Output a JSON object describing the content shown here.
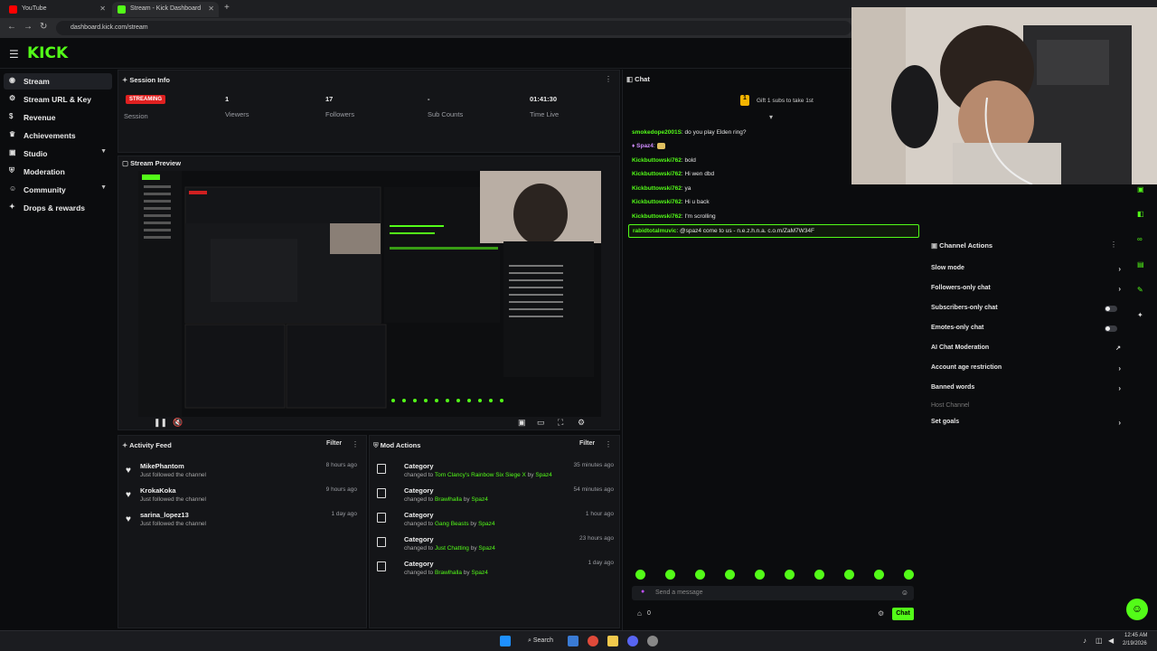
{
  "browser": {
    "tabs": [
      {
        "label": "YouTube",
        "active": false
      },
      {
        "label": "Stream - Kick Dashboard",
        "active": true
      }
    ],
    "url": "dashboard.kick.com/stream"
  },
  "brand": {
    "logo": "KICK",
    "accent": "#53fc18"
  },
  "sidebar": {
    "items": [
      {
        "label": "Stream",
        "icon": "broadcast-icon",
        "active": true
      },
      {
        "label": "Stream URL & Key",
        "icon": "gear-icon"
      },
      {
        "label": "Revenue",
        "icon": "dollar-icon"
      },
      {
        "label": "Achievements",
        "icon": "trophy-icon"
      },
      {
        "label": "Studio",
        "icon": "studio-icon",
        "expandable": true
      },
      {
        "label": "Moderation",
        "icon": "shield-icon"
      },
      {
        "label": "Community",
        "icon": "community-icon",
        "expandable": true
      },
      {
        "label": "Drops & rewards",
        "icon": "gift-icon"
      }
    ]
  },
  "session": {
    "title": "Session Info",
    "badge": "STREAMING",
    "badge_label": "Session",
    "stats": [
      {
        "value": "1",
        "label": "Viewers"
      },
      {
        "value": "17",
        "label": "Followers"
      },
      {
        "value": "-",
        "label": "Sub Counts"
      },
      {
        "value": "01:41:30",
        "label": "Time Live"
      }
    ]
  },
  "preview": {
    "title": "Stream Preview"
  },
  "activity": {
    "title": "Activity Feed",
    "filter": "Filter",
    "items": [
      {
        "name": "MikePhantom",
        "sub": "Just followed the channel",
        "time": "8 hours ago"
      },
      {
        "name": "KrokaKoka",
        "sub": "Just followed the channel",
        "time": "9 hours ago"
      },
      {
        "name": "sarina_lopez13",
        "sub": "Just followed the channel",
        "time": "1 day ago"
      }
    ]
  },
  "mod_actions": {
    "title": "Mod Actions",
    "filter": "Filter",
    "items": [
      {
        "name": "Category",
        "prefix": "changed to",
        "target": "Tom Clancy's Rainbow Six Siege X",
        "by": "by",
        "user": "Spaz4",
        "time": "35 minutes ago"
      },
      {
        "name": "Category",
        "prefix": "changed to",
        "target": "Brawlhalla",
        "by": "by",
        "user": "Spaz4",
        "time": "54 minutes ago"
      },
      {
        "name": "Category",
        "prefix": "changed to",
        "target": "Gang Beasts",
        "by": "by",
        "user": "Spaz4",
        "time": "1 hour ago"
      },
      {
        "name": "Category",
        "prefix": "changed to",
        "target": "Just Chatting",
        "by": "by",
        "user": "Spaz4",
        "time": "23 hours ago"
      },
      {
        "name": "Category",
        "prefix": "changed to",
        "target": "Brawlhalla",
        "by": "by",
        "user": "Spaz4",
        "time": "1 day ago"
      }
    ]
  },
  "chat": {
    "title": "Chat",
    "gift_text": "Gift 1 subs to take 1st",
    "gift_count": "1",
    "messages": [
      {
        "user": "smokedope2001S",
        "text": "do you play Elden ring?",
        "color": "#53fc18"
      },
      {
        "user": "Spaz4",
        "text": "",
        "color": "#d08cff"
      },
      {
        "user": "Kickbuttowski762",
        "text": "bold",
        "color": "#53fc18"
      },
      {
        "user": "Kickbuttowski762",
        "text": "Hi wen dbd",
        "color": "#53fc18"
      },
      {
        "user": "Kickbuttowski762",
        "text": "ya",
        "color": "#53fc18"
      },
      {
        "user": "Kickbuttowski762",
        "text": "Hi u back",
        "color": "#53fc18"
      },
      {
        "user": "Kickbuttowski762",
        "text": "I'm scrolling",
        "color": "#53fc18"
      },
      {
        "user": "rabidtotalmuvic",
        "text": "@spaz4 come to us - n.e.z.h.n.a. c.o.m/ZaM7W34F",
        "color": "#53fc18"
      }
    ],
    "input_placeholder": "Send a message",
    "count": "0",
    "send_label": "Chat"
  },
  "channel_actions": {
    "title": "Channel Actions",
    "items": [
      {
        "label": "Slow mode",
        "control": "arrow"
      },
      {
        "label": "Followers-only chat",
        "control": "arrow"
      },
      {
        "label": "Subscribers-only chat",
        "control": "toggle"
      },
      {
        "label": "Emotes-only chat",
        "control": "toggle"
      },
      {
        "label": "AI Chat Moderation",
        "control": "external"
      },
      {
        "label": "Account age restriction",
        "control": "arrow"
      },
      {
        "label": "Banned words",
        "control": "arrow"
      },
      {
        "label": "Host Channel",
        "control": "none"
      },
      {
        "label": "Set goals",
        "control": "arrow"
      }
    ]
  },
  "taskbar": {
    "search": "Search",
    "time": "12:45 AM",
    "date": "2/19/2026"
  }
}
